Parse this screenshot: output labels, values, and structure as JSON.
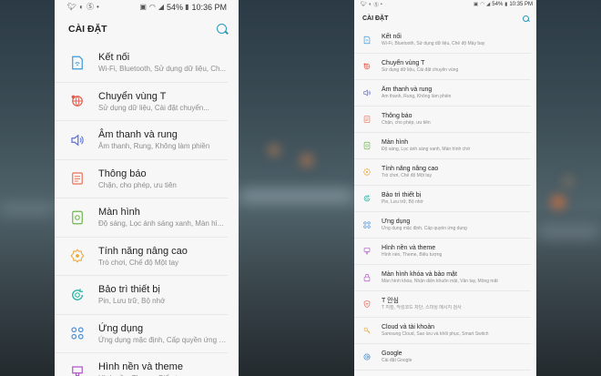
{
  "left_phone": {
    "status_bar": {
      "time": "10:36 PM",
      "battery": "54%",
      "left_icons": [
        "twitter-icon",
        "messenger-icon",
        "skype-icon",
        "ellipsis-icon"
      ],
      "right_icons": [
        "cast-icon",
        "wifi-icon",
        "signal-icon",
        "battery-icon"
      ]
    },
    "header": {
      "title": "CÀI ĐẶT"
    },
    "items": [
      {
        "label": "Kết nối",
        "desc": "Wi-Fi, Bluetooth, Sử dụng dữ liệu, Ch...",
        "icon": "connections-icon",
        "color": "#3a9ad9"
      },
      {
        "label": "Chuyển vùng T",
        "desc": "Sử dụng dữ liệu, Cài đặt chuyển...",
        "icon": "roaming-icon",
        "color": "#e85b4c"
      },
      {
        "label": "Âm thanh và rung",
        "desc": "Âm thanh, Rung, Không làm phiền",
        "icon": "sound-icon",
        "color": "#5b6fd6"
      },
      {
        "label": "Thông báo",
        "desc": "Chặn, cho phép, ưu tiên",
        "icon": "notifications-icon",
        "color": "#e8735a"
      },
      {
        "label": "Màn hình",
        "desc": "Độ sáng, Lọc ánh sáng xanh, Màn hì...",
        "icon": "display-icon",
        "color": "#6bb84a"
      },
      {
        "label": "Tính năng nâng cao",
        "desc": "Trò chơi, Chế độ Một tay",
        "icon": "advanced-features-icon",
        "color": "#e8a93a"
      },
      {
        "label": "Bảo trì thiết bị",
        "desc": "Pin, Lưu trữ, Bộ nhớ",
        "icon": "device-maintenance-icon",
        "color": "#27b3a2"
      },
      {
        "label": "Ứng dụng",
        "desc": "Ứng dụng mặc định, Cấp quyền ứng d...",
        "icon": "apps-icon",
        "color": "#4a8fd6"
      },
      {
        "label": "Hình nền và theme",
        "desc": "Hình nền, Theme, Biểu tượng",
        "icon": "wallpaper-themes-icon",
        "color": "#b057c8"
      }
    ]
  },
  "right_phone": {
    "status_bar": {
      "time": "10:35 PM",
      "battery": "54%",
      "left_icons": [
        "twitter-icon",
        "messenger-icon",
        "skype-icon",
        "ellipsis-icon"
      ],
      "right_icons": [
        "cast-icon",
        "wifi-icon",
        "signal-icon",
        "battery-icon"
      ]
    },
    "header": {
      "title": "CÀI ĐẶT"
    },
    "items": [
      {
        "label": "Kết nối",
        "desc": "Wi-Fi, Bluetooth, Sử dụng dữ liệu, Chế độ Máy bay",
        "icon": "connections-icon",
        "color": "#3a9ad9"
      },
      {
        "label": "Chuyển vùng T",
        "desc": "Sử dụng dữ liệu, Cài đặt chuyển vùng",
        "icon": "roaming-icon",
        "color": "#e85b4c"
      },
      {
        "label": "Âm thanh và rung",
        "desc": "Âm thanh, Rung, Không làm phiền",
        "icon": "sound-icon",
        "color": "#5b6fd6"
      },
      {
        "label": "Thông báo",
        "desc": "Chặn, cho phép, ưu tiên",
        "icon": "notifications-icon",
        "color": "#e8735a"
      },
      {
        "label": "Màn hình",
        "desc": "Độ sáng, Lọc ánh sáng xanh, Màn hình chờ",
        "icon": "display-icon",
        "color": "#6bb84a"
      },
      {
        "label": "Tính năng nâng cao",
        "desc": "Trò chơi, Chế độ Một tay",
        "icon": "advanced-features-icon",
        "color": "#e8a93a"
      },
      {
        "label": "Bảo trì thiết bị",
        "desc": "Pin, Lưu trữ, Bộ nhớ",
        "icon": "device-maintenance-icon",
        "color": "#27b3a2"
      },
      {
        "label": "Ứng dụng",
        "desc": "Ứng dụng mặc định, Cấp quyền ứng dụng",
        "icon": "apps-icon",
        "color": "#4a8fd6"
      },
      {
        "label": "Hình nền và theme",
        "desc": "Hình nền, Theme, Biểu tượng",
        "icon": "wallpaper-themes-icon",
        "color": "#b057c8"
      },
      {
        "label": "Màn hình khóa và bảo mật",
        "desc": "Màn hình khóa, Nhận diện khuôn mặt, Vân tay, Mống mắt",
        "icon": "lock-screen-security-icon",
        "color": "#b057c8"
      },
      {
        "label": "T 안심",
        "desc": "T 지킴, 악성코드 차단, 스미싱 메시지 검사",
        "icon": "t-safety-icon",
        "color": "#e85b4c"
      },
      {
        "label": "Cloud và tài khoản",
        "desc": "Samsung Cloud, Sao lưu và khôi phục, Smart Switch",
        "icon": "cloud-accounts-icon",
        "color": "#e8a93a"
      },
      {
        "label": "Google",
        "desc": "Cài đặt Google",
        "icon": "google-icon",
        "color": "#4a8fd6"
      }
    ]
  }
}
